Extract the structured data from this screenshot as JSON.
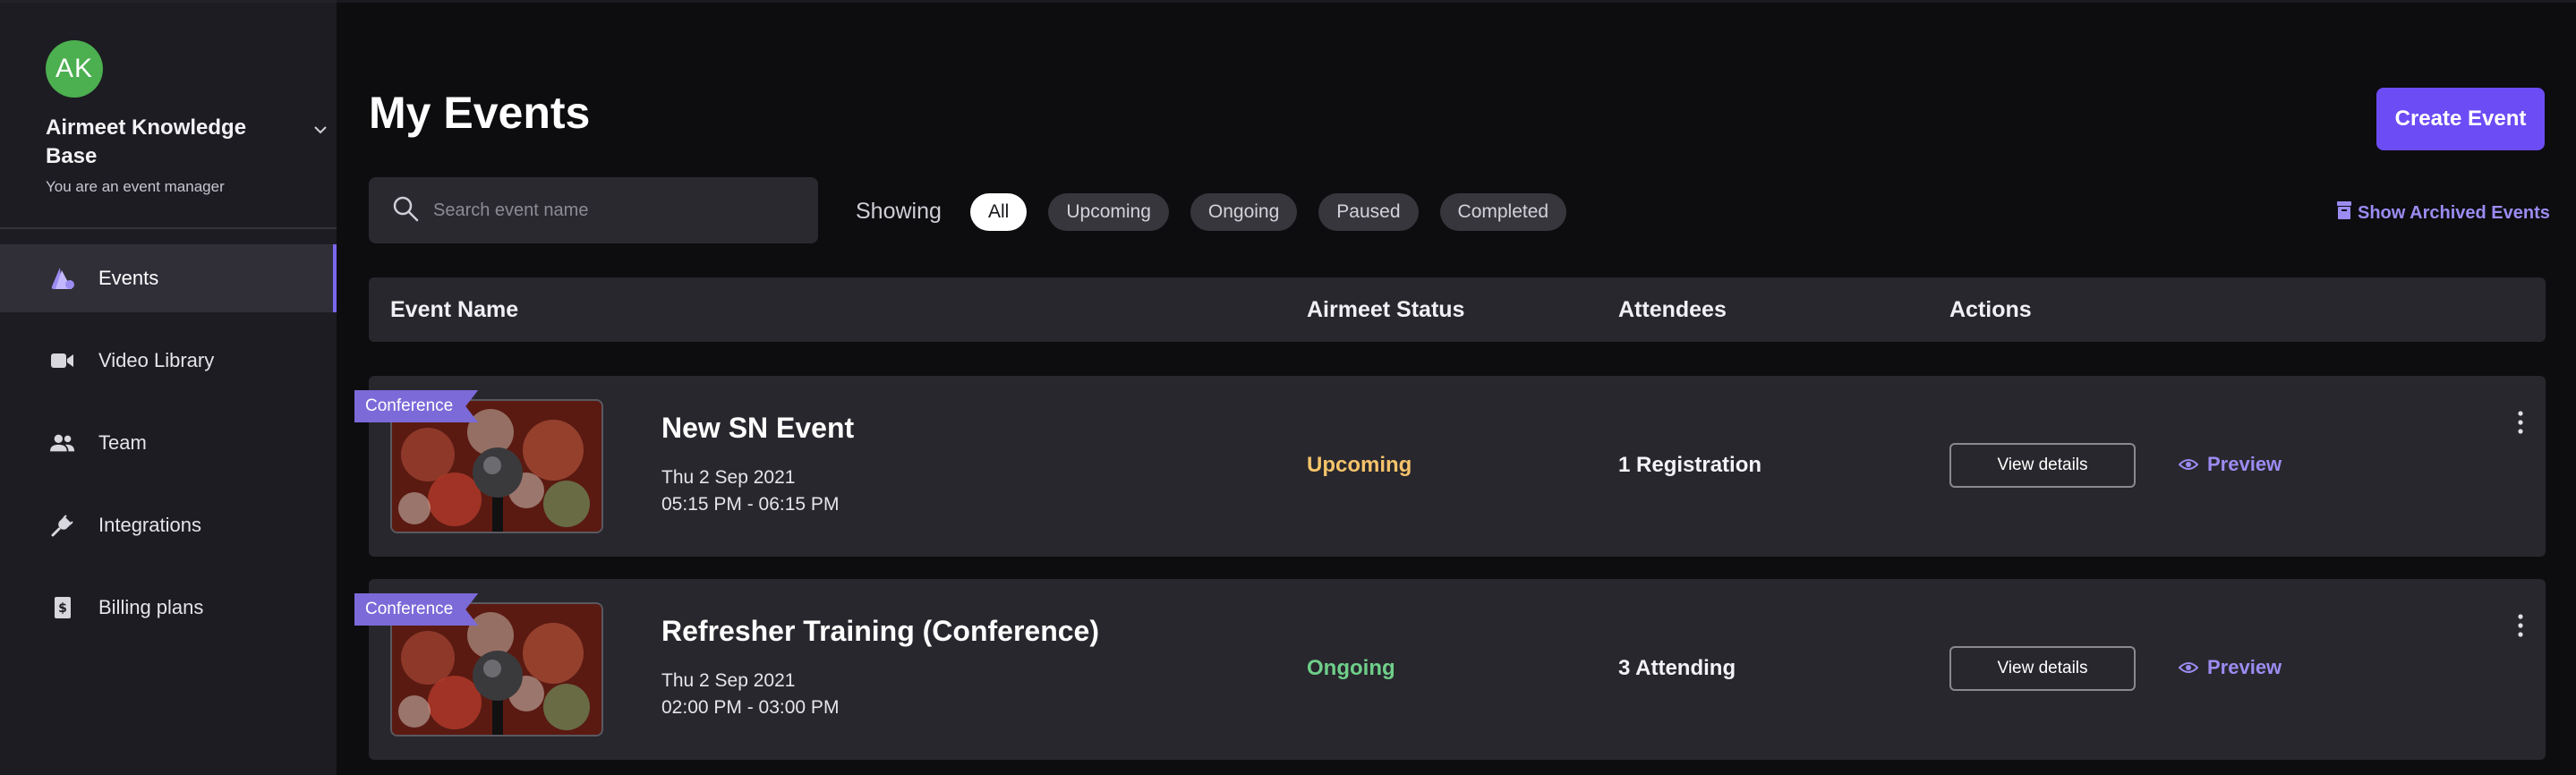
{
  "sidebar": {
    "avatar_initials": "AK",
    "org_name": "Airmeet Knowledge Base",
    "role": "You are an event manager",
    "items": [
      {
        "label": "Events",
        "icon": "events-icon"
      },
      {
        "label": "Video Library",
        "icon": "video-icon"
      },
      {
        "label": "Team",
        "icon": "team-icon"
      },
      {
        "label": "Integrations",
        "icon": "plug-icon"
      },
      {
        "label": "Billing plans",
        "icon": "billing-icon"
      }
    ]
  },
  "header": {
    "title": "My Events",
    "create_label": "Create Event"
  },
  "search": {
    "placeholder": "Search event name"
  },
  "filters": {
    "label": "Showing",
    "options": [
      "All",
      "Upcoming",
      "Ongoing",
      "Paused",
      "Completed"
    ],
    "selected": "All",
    "archived_label": "Show Archived Events"
  },
  "table": {
    "columns": [
      "Event Name",
      "Airmeet Status",
      "Attendees",
      "Actions"
    ],
    "rows": [
      {
        "tag": "Conference",
        "name": "New SN Event",
        "date": "Thu 2 Sep 2021",
        "time": "05:15 PM - 06:15 PM",
        "status": "Upcoming",
        "attendees": "1 Registration",
        "view_label": "View details",
        "preview_label": "Preview"
      },
      {
        "tag": "Conference",
        "name": "Refresher Training (Conference)",
        "date": "Thu 2 Sep 2021",
        "time": "02:00 PM - 03:00 PM",
        "status": "Ongoing",
        "attendees": "3 Attending",
        "view_label": "View details",
        "preview_label": "Preview"
      }
    ]
  },
  "colors": {
    "accent": "#6c4cf5",
    "link": "#9b8cf2",
    "status_upcoming": "#f5c36b",
    "status_ongoing": "#6fcf8a",
    "avatar": "#4caf50"
  }
}
